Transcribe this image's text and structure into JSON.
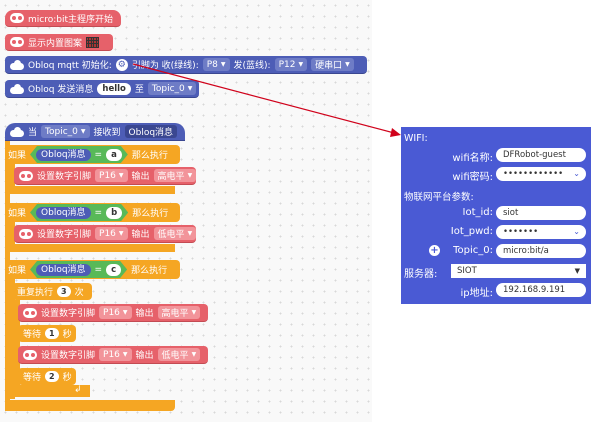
{
  "blocks": {
    "start": "micro:bit主程序开始",
    "show_image": "显示内置图案",
    "mqtt_init": {
      "text": "Obloq mqtt 初始化:",
      "pin_rx_label": "引脚为 收(绿线):",
      "rx_pin": "P8",
      "tx_label": "发(蓝线):",
      "tx_pin": "P12",
      "serial": "硬串口"
    },
    "send": {
      "label": "Obloq 发送消息",
      "msg": "hello",
      "to": "至",
      "topic": "Topic_0"
    },
    "event": {
      "when": "当",
      "topic": "Topic_0",
      "received": "接收到",
      "obloq_msg": "Obloq消息"
    },
    "if_label": "如果",
    "then_label": "那么执行",
    "obloq_msg": "Obloq消息",
    "eq": "=",
    "set_pin": "设置数字引脚",
    "pin": "P16",
    "output": "输出",
    "high": "高电平",
    "low": "低电平",
    "cond_a": "a",
    "cond_b": "b",
    "cond_c": "c",
    "repeat": {
      "label": "重复执行",
      "count": "3",
      "times": "次"
    },
    "wait": {
      "label": "等待",
      "unit": "秒",
      "v1": "1",
      "v2": "2"
    }
  },
  "panel": {
    "wifi_header": "WIFI:",
    "wifi_name_label": "wifi名称:",
    "wifi_name": "DFRobot-guest",
    "wifi_pwd_label": "wifi密码:",
    "wifi_pwd": "••••••••••••",
    "iot_header": "物联网平台参数:",
    "iot_id_label": "Iot_id:",
    "iot_id": "siot",
    "iot_pwd_label": "Iot_pwd:",
    "iot_pwd": "•••••••",
    "topic_label": "Topic_0:",
    "topic_value": "micro:bit/a",
    "server_label": "服务器:",
    "server_value": "SIOT",
    "ip_label": "ip地址:",
    "ip_value": "192.168.9.191"
  },
  "colors": {
    "red_block": "#e6616a",
    "blue_block": "#4d5db6",
    "orange_block": "#f5a623",
    "green_cond": "#58b958",
    "panel": "#4a5ad4",
    "arrow": "#d0021b"
  }
}
